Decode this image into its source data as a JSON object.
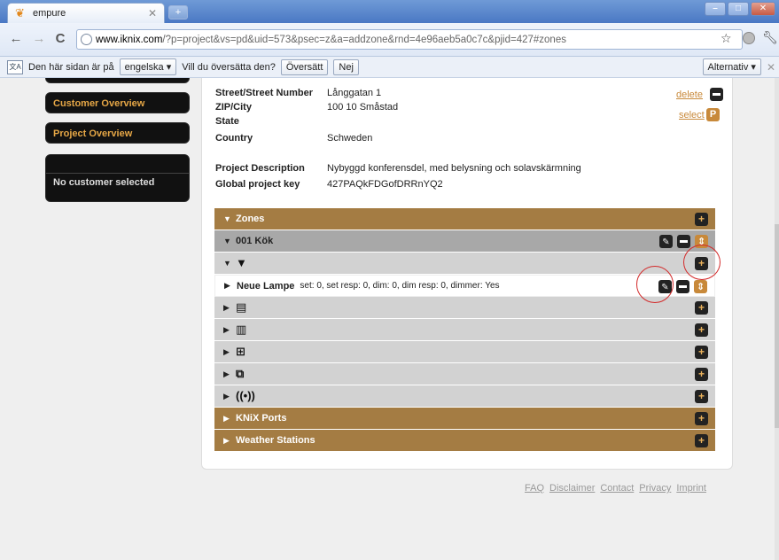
{
  "browser": {
    "tab_title": "empure",
    "url_host": "www.iknix.com",
    "url_path": "/?p=project&vs=pd&uid=573&psec=z&a=addzone&rnd=4e96aeb5a0c7c&pjid=427#zones",
    "newtab_label": "+"
  },
  "translate_bar": {
    "prefix": "Den här sidan är på",
    "language": "engelska ▾",
    "question": "Vill du översätta den?",
    "translate_btn": "Översätt",
    "no_btn": "Nej",
    "options_btn": "Alternativ ▾"
  },
  "sidebar": {
    "customer_overview": "Customer Overview",
    "project_overview": "Project Overview",
    "no_customer": "No customer selected"
  },
  "project": {
    "fields": [
      {
        "label": "Street/Street Number",
        "value": "Långgatan 1"
      },
      {
        "label": "ZIP/City",
        "value": "100 10 Småstad"
      },
      {
        "label": "State",
        "value": ""
      },
      {
        "label": "Country",
        "value": "Schweden"
      }
    ],
    "description_label": "Project Description",
    "description": "Nybyggd konferensdel, med belysning och solavskärmning",
    "key_label": "Global project key",
    "key": "427PAQkFDGofDRRnYQ2",
    "delete_link": "delete",
    "select_link": "select",
    "select_badge": "P"
  },
  "tree": {
    "zones": "Zones",
    "zone_001": "001 Kök",
    "device_name": "Neue Lampe",
    "device_detail": "set: 0, set resp: 0, dim: 0, dim resp: 0, dimmer: Yes",
    "knix_ports": "KNiX Ports",
    "weather_stations": "Weather Stations",
    "category_icons": [
      "lamp-icon",
      "blind-icon",
      "heater-icon",
      "switch-group-icon",
      "scene-icon",
      "sensor-icon"
    ]
  },
  "footer": {
    "links": [
      "FAQ",
      "Disclaimer",
      "Contact",
      "Privacy",
      "Imprint"
    ]
  }
}
